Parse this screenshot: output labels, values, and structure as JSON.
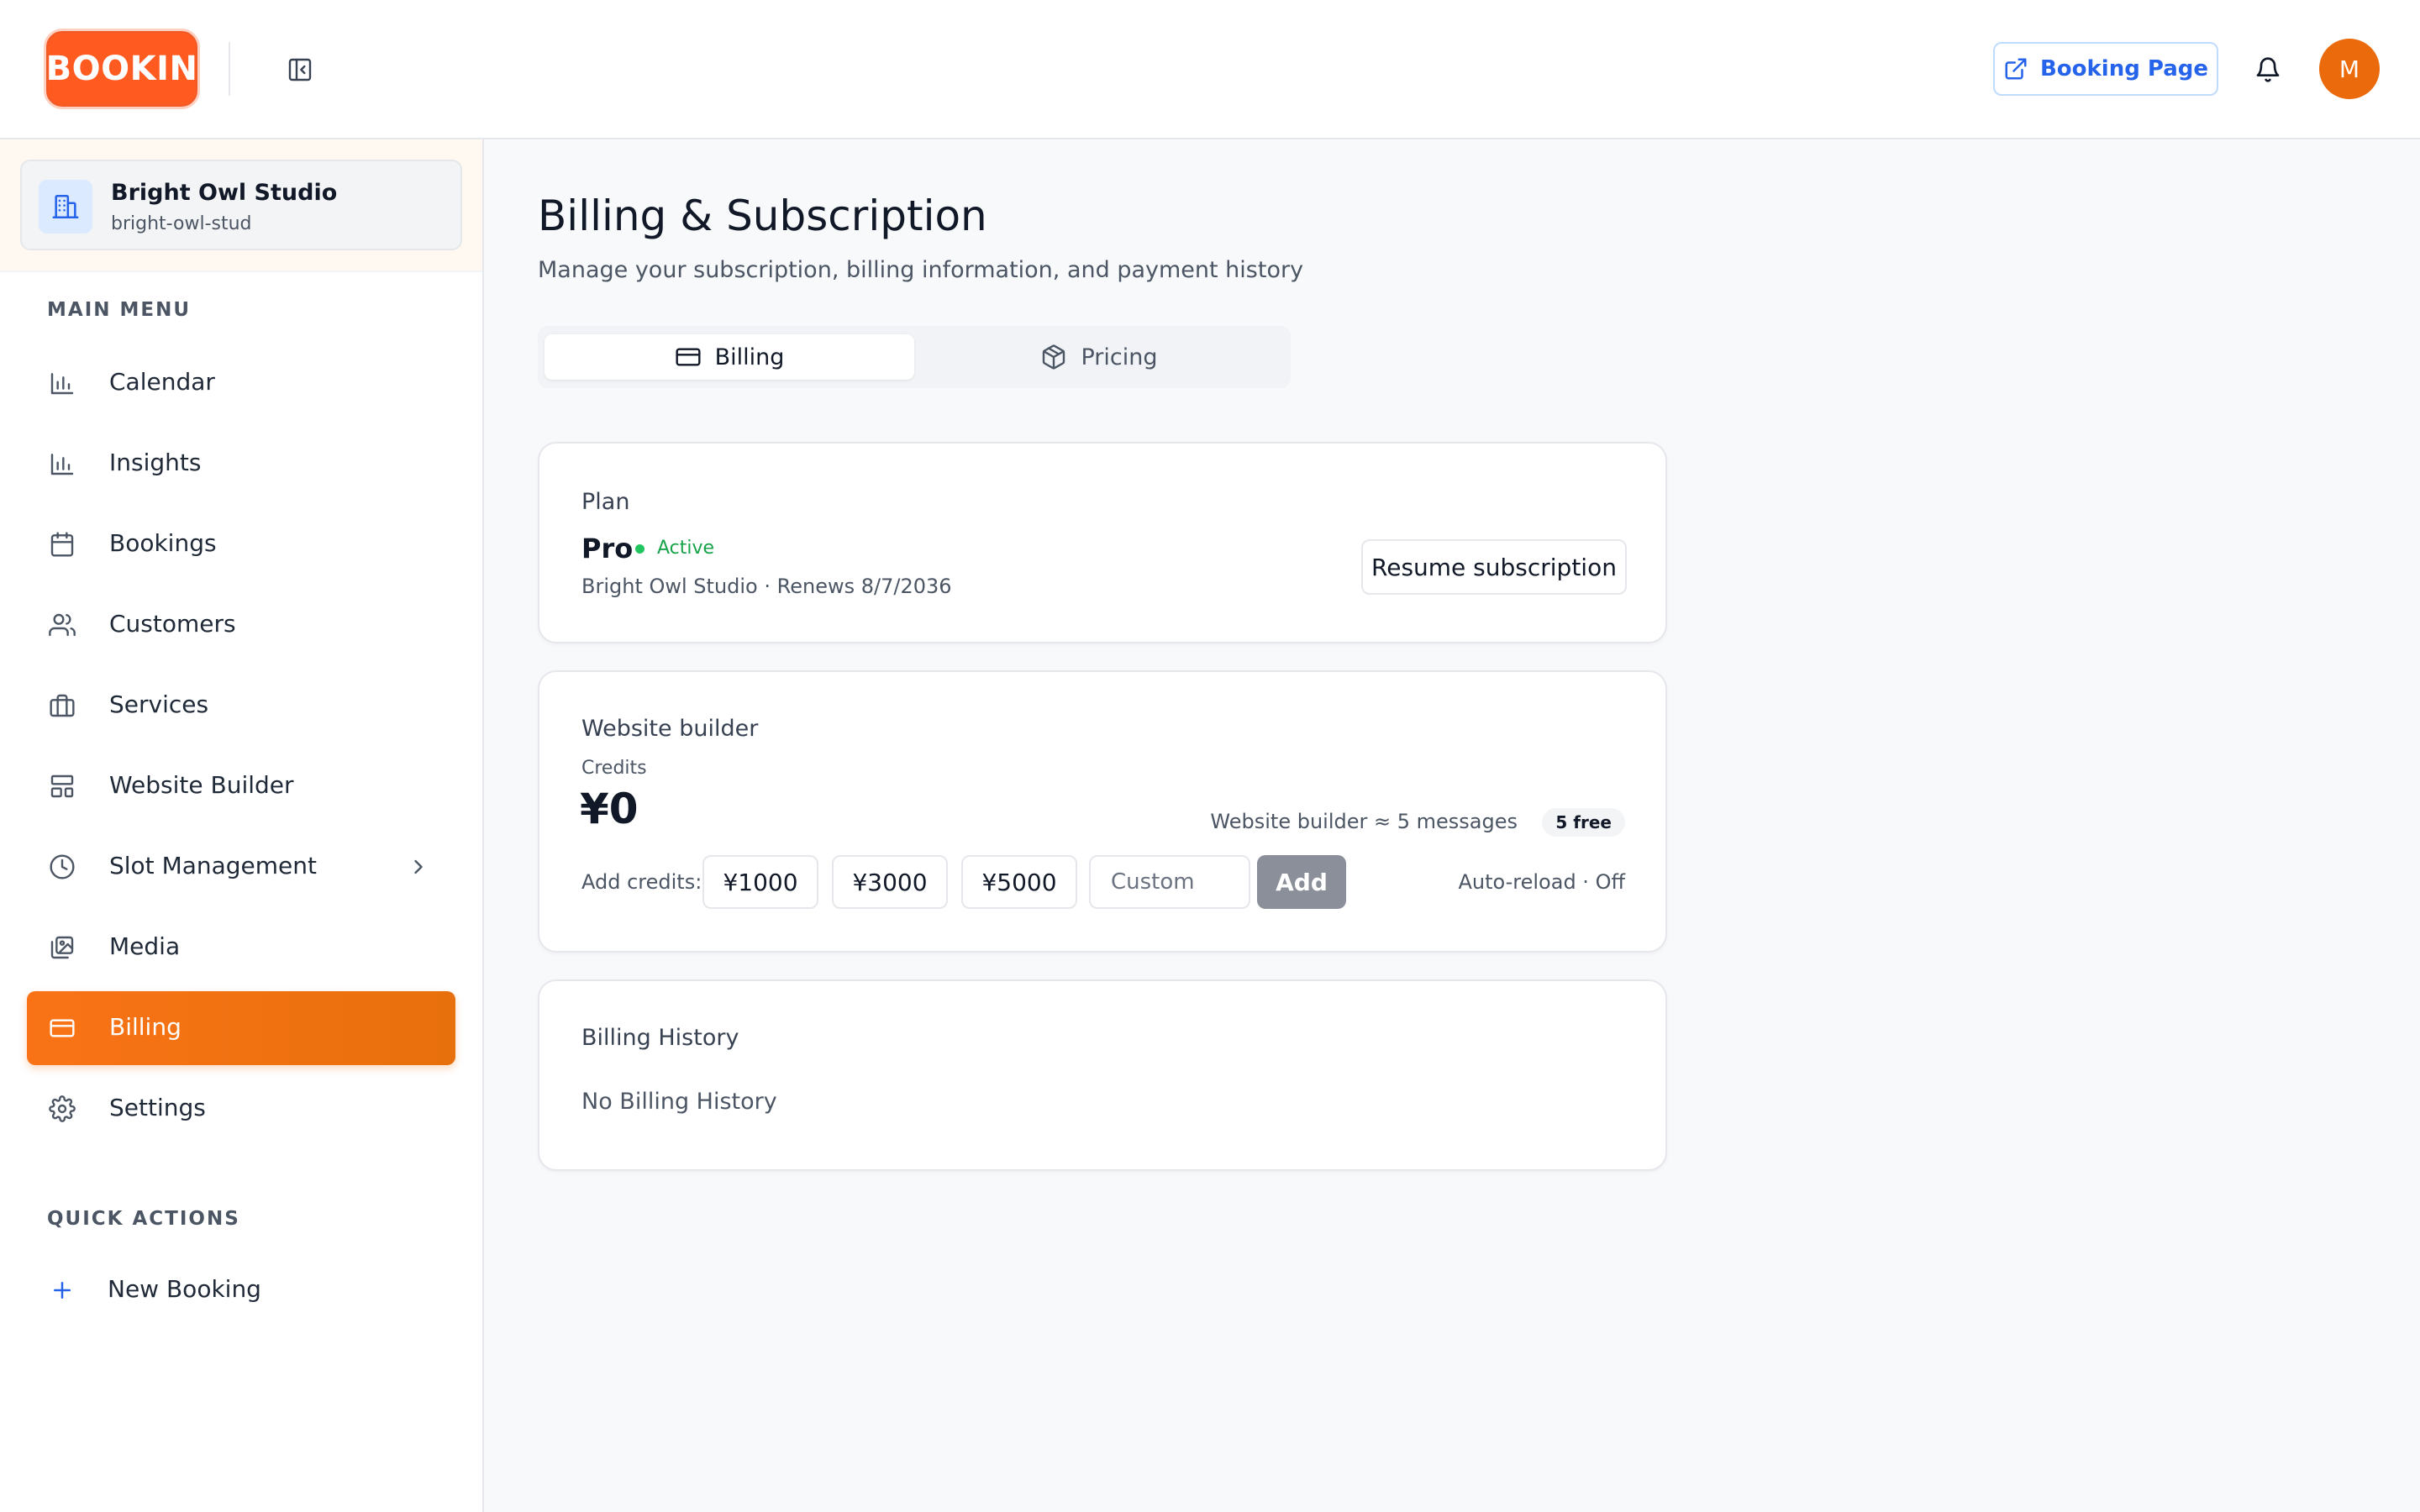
{
  "header": {
    "logo_text": "BOOKIN",
    "booking_page_label": "Booking Page",
    "avatar_initial": "M"
  },
  "workspace": {
    "name": "Bright Owl Studio",
    "slug": "bright-owl-stud"
  },
  "sidebar": {
    "main_menu_label": "MAIN MENU",
    "items": [
      {
        "label": "Calendar",
        "icon": "bar-chart-icon"
      },
      {
        "label": "Insights",
        "icon": "bar-chart-icon"
      },
      {
        "label": "Bookings",
        "icon": "calendar-icon"
      },
      {
        "label": "Customers",
        "icon": "users-icon"
      },
      {
        "label": "Services",
        "icon": "briefcase-icon"
      },
      {
        "label": "Website Builder",
        "icon": "layout-icon"
      },
      {
        "label": "Slot Management",
        "icon": "clock-icon"
      },
      {
        "label": "Media",
        "icon": "images-icon"
      },
      {
        "label": "Billing",
        "icon": "credit-card-icon"
      },
      {
        "label": "Settings",
        "icon": "gear-icon"
      }
    ],
    "active_item": "Billing",
    "quick_actions_label": "QUICK ACTIONS",
    "quick_actions": [
      {
        "label": "New Booking",
        "icon": "plus-icon"
      }
    ]
  },
  "page": {
    "title": "Billing & Subscription",
    "subtitle": "Manage your subscription, billing information, and payment history"
  },
  "tabs": [
    {
      "label": "Billing",
      "active": true
    },
    {
      "label": "Pricing",
      "active": false
    }
  ],
  "plan_card": {
    "title": "Plan",
    "plan_name": "Pro",
    "status": "Active",
    "meta": "Bright Owl Studio · Renews 8/7/2036",
    "resume_label": "Resume subscription"
  },
  "website_card": {
    "title": "Website builder",
    "credits_label": "Credits",
    "credits_value": "¥0",
    "usage_text": "Website builder ≈ 5 messages",
    "free_badge": "5 free",
    "add_credits_label": "Add credits:",
    "amounts": [
      "¥1000",
      "¥3000",
      "¥5000"
    ],
    "custom_placeholder": "Custom",
    "add_label": "Add",
    "autoreload_text": "Auto-reload · Off"
  },
  "history_card": {
    "title": "Billing History",
    "empty_text": "No Billing History"
  },
  "colors": {
    "accent": "#f97316",
    "link": "#2563eb",
    "active_status": "#22c55e"
  }
}
